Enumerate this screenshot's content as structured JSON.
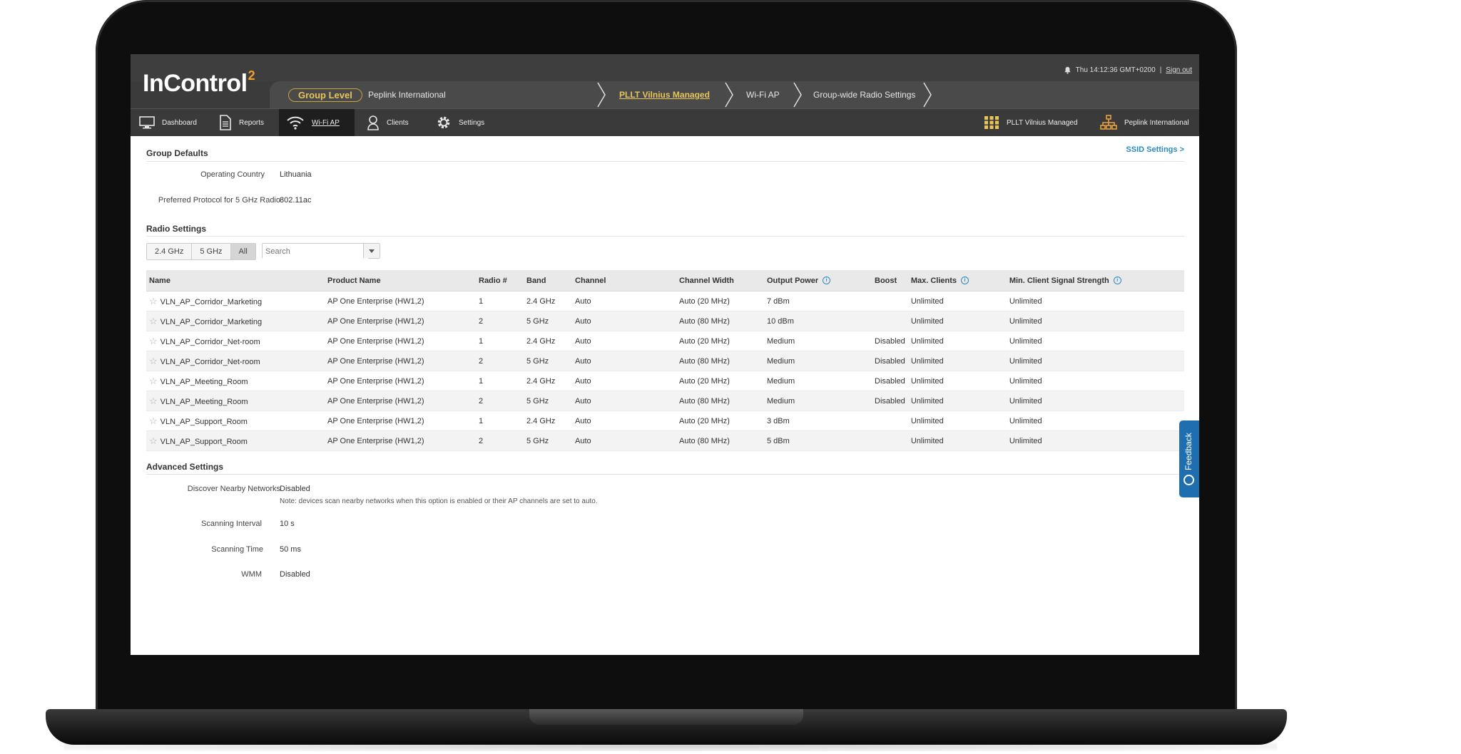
{
  "header": {
    "logo": "InControl",
    "logo_sup": "2",
    "datetime": "Thu 14:12:36 GMT+0200",
    "separator": "|",
    "sign_out": "Sign out"
  },
  "breadcrumbs": {
    "group_level": "Group Level",
    "org": "Peplink International",
    "group": "PLLT Vilnius Managed",
    "section": "Wi-Fi AP",
    "page": "Group-wide Radio Settings"
  },
  "nav": {
    "dashboard": "Dashboard",
    "reports": "Reports",
    "wifi_ap": "Wi-Fi AP",
    "clients": "Clients",
    "settings": "Settings",
    "group_switch": "PLLT Vilnius Managed",
    "org_switch": "Peplink International"
  },
  "group_defaults": {
    "title": "Group Defaults",
    "ssid_link": "SSID Settings >",
    "country_label": "Operating Country",
    "country_value": "Lithuania",
    "protocol_label": "Preferred Protocol for 5 GHz Radio",
    "protocol_value": "802.11ac"
  },
  "radio_settings": {
    "title": "Radio Settings",
    "filters": [
      "2.4 GHz",
      "5 GHz",
      "All"
    ],
    "selected_filter": "All",
    "search_placeholder": "Search",
    "columns": [
      "Name",
      "Product Name",
      "Radio #",
      "Band",
      "Channel",
      "Channel Width",
      "Output Power",
      "Boost",
      "Max. Clients",
      "Min. Client Signal Strength"
    ],
    "rows": [
      {
        "name": "VLN_AP_Corridor_Marketing",
        "product": "AP One Enterprise (HW1,2)",
        "radio": "1",
        "band": "2.4 GHz",
        "channel": "Auto",
        "width": "Auto (20 MHz)",
        "power": "7 dBm",
        "boost": "",
        "max_clients": "Unlimited",
        "min_signal": "Unlimited"
      },
      {
        "name": "VLN_AP_Corridor_Marketing",
        "product": "AP One Enterprise (HW1,2)",
        "radio": "2",
        "band": "5 GHz",
        "channel": "Auto",
        "width": "Auto (80 MHz)",
        "power": "10 dBm",
        "boost": "",
        "max_clients": "Unlimited",
        "min_signal": "Unlimited"
      },
      {
        "name": "VLN_AP_Corridor_Net-room",
        "product": "AP One Enterprise (HW1,2)",
        "radio": "1",
        "band": "2.4 GHz",
        "channel": "Auto",
        "width": "Auto (20 MHz)",
        "power": "Medium",
        "boost": "Disabled",
        "max_clients": "Unlimited",
        "min_signal": "Unlimited"
      },
      {
        "name": "VLN_AP_Corridor_Net-room",
        "product": "AP One Enterprise (HW1,2)",
        "radio": "2",
        "band": "5 GHz",
        "channel": "Auto",
        "width": "Auto (80 MHz)",
        "power": "Medium",
        "boost": "Disabled",
        "max_clients": "Unlimited",
        "min_signal": "Unlimited"
      },
      {
        "name": "VLN_AP_Meeting_Room",
        "product": "AP One Enterprise (HW1,2)",
        "radio": "1",
        "band": "2.4 GHz",
        "channel": "Auto",
        "width": "Auto (20 MHz)",
        "power": "Medium",
        "boost": "Disabled",
        "max_clients": "Unlimited",
        "min_signal": "Unlimited"
      },
      {
        "name": "VLN_AP_Meeting_Room",
        "product": "AP One Enterprise (HW1,2)",
        "radio": "2",
        "band": "5 GHz",
        "channel": "Auto",
        "width": "Auto (80 MHz)",
        "power": "Medium",
        "boost": "Disabled",
        "max_clients": "Unlimited",
        "min_signal": "Unlimited"
      },
      {
        "name": "VLN_AP_Support_Room",
        "product": "AP One Enterprise (HW1,2)",
        "radio": "1",
        "band": "2.4 GHz",
        "channel": "Auto",
        "width": "Auto (20 MHz)",
        "power": "3 dBm",
        "boost": "",
        "max_clients": "Unlimited",
        "min_signal": "Unlimited"
      },
      {
        "name": "VLN_AP_Support_Room",
        "product": "AP One Enterprise (HW1,2)",
        "radio": "2",
        "band": "5 GHz",
        "channel": "Auto",
        "width": "Auto (80 MHz)",
        "power": "5 dBm",
        "boost": "",
        "max_clients": "Unlimited",
        "min_signal": "Unlimited"
      }
    ]
  },
  "advanced": {
    "title": "Advanced Settings",
    "discover_label": "Discover Nearby Networks",
    "discover_value": "Disabled",
    "discover_note": "Note: devices scan nearby networks when this option is enabled or their AP channels are set to auto.",
    "interval_label": "Scanning Interval",
    "interval_value": "10 s",
    "time_label": "Scanning Time",
    "time_value": "50 ms",
    "wmm_label": "WMM",
    "wmm_value": "Disabled"
  },
  "feedback": "Feedback",
  "colors": {
    "accent": "#2a8bc0",
    "gold": "#e8c55a",
    "feedback": "#1f6fb0"
  }
}
